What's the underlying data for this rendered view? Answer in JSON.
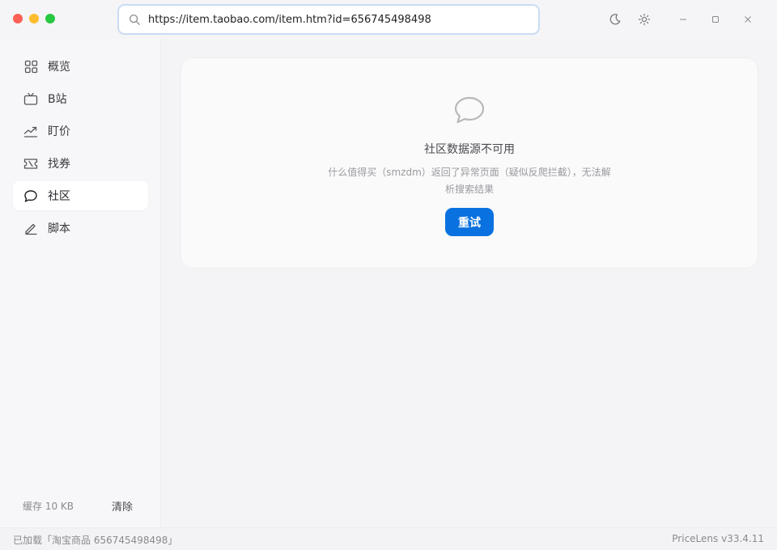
{
  "window": {
    "url_value": "https://item.taobao.com/item.htm?id=656745498498"
  },
  "toolbar": {
    "icons": [
      "search-icon",
      "moon-icon",
      "sun-icon",
      "minimize-icon",
      "maximize-icon",
      "close-icon"
    ]
  },
  "sidebar": {
    "items": [
      {
        "label": "概览",
        "icon": "grid-icon",
        "active": false
      },
      {
        "label": "B站",
        "icon": "tv-icon",
        "active": false
      },
      {
        "label": "盯价",
        "icon": "trend-icon",
        "active": false
      },
      {
        "label": "找券",
        "icon": "ticket-icon",
        "active": false
      },
      {
        "label": "社区",
        "icon": "chat-icon",
        "active": true
      },
      {
        "label": "脚本",
        "icon": "pen-icon",
        "active": false
      }
    ],
    "cache_label": "缓存 10 KB",
    "clear_label": "清除"
  },
  "main": {
    "error_title": "社区数据源不可用",
    "error_desc": "什么值得买（smzdm）返回了异常页面（疑似反爬拦截），无法解析搜索结果",
    "retry_label": "重试"
  },
  "status": {
    "left": "已加载「淘宝商品 656745498498」",
    "right": "PriceLens v33.4.11"
  },
  "colors": {
    "accent": "#0a72e0",
    "traffic_red": "#fe5f57",
    "traffic_yellow": "#febc2e",
    "traffic_green": "#28c840"
  }
}
